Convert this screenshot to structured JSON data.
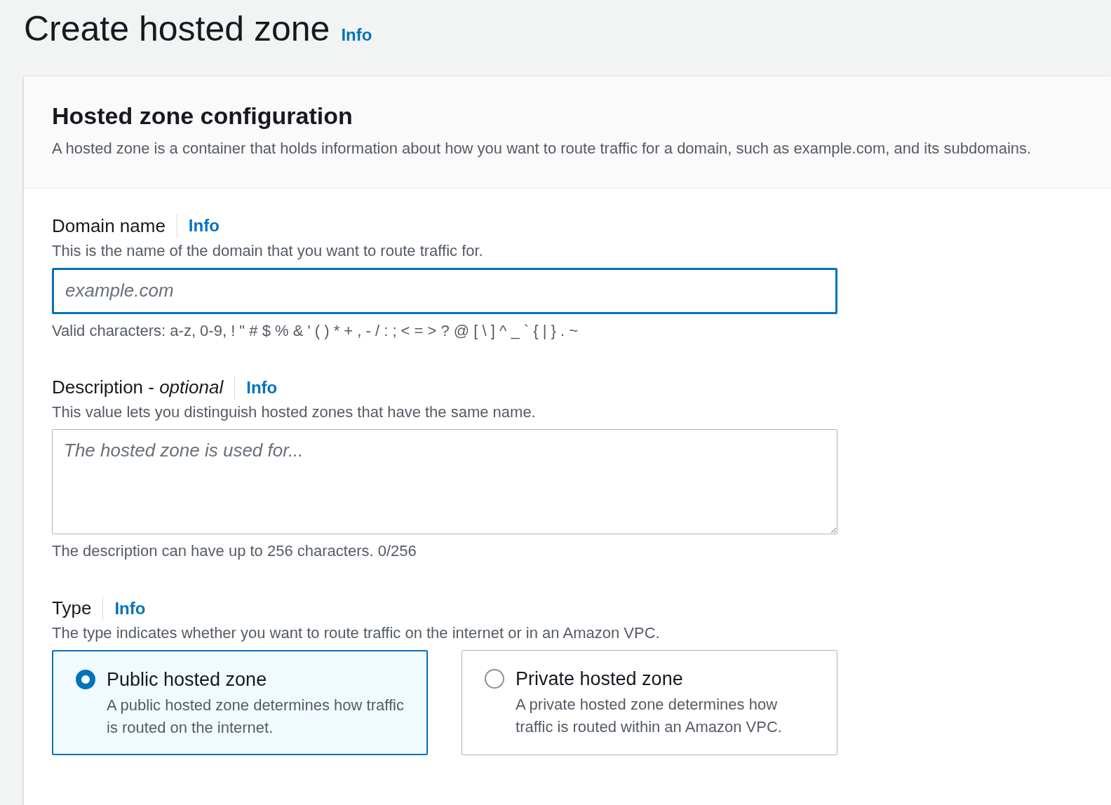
{
  "page": {
    "title": "Create hosted zone",
    "info": "Info"
  },
  "section": {
    "title": "Hosted zone configuration",
    "description": "A hosted zone is a container that holds information about how you want to route traffic for a domain, such as example.com, and its subdomains."
  },
  "fields": [
    {
      "kind": "input",
      "label": "Domain name",
      "info": "Info",
      "description": "This is the name of the domain that you want to route traffic for.",
      "placeholder": "example.com",
      "focused": true,
      "constraint": "Valid characters: a-z, 0-9, ! \" # $ % & ' ( ) * + , - / : ; < = > ? @ [ \\ ] ^ _ ` { | } . ~"
    },
    {
      "kind": "textarea",
      "label": "Description - *optional*",
      "info": "Info",
      "description": "This value lets you distinguish hosted zones that have the same name.",
      "placeholder": "The hosted zone is used for...",
      "focused": false,
      "constraint": "The description can have up to 256 characters. 0/256"
    },
    {
      "kind": "tiles",
      "label": "Type",
      "info": "Info",
      "description": "The type indicates whether you want to route traffic on the internet or in an Amazon VPC.",
      "options": [
        {
          "label": "Public hosted zone",
          "description": "A public hosted zone determines how traffic is routed on the internet.",
          "selected": true
        },
        {
          "label": "Private hosted zone",
          "description": "A private hosted zone determines how traffic is routed within an Amazon VPC.",
          "selected": false
        }
      ]
    }
  ]
}
